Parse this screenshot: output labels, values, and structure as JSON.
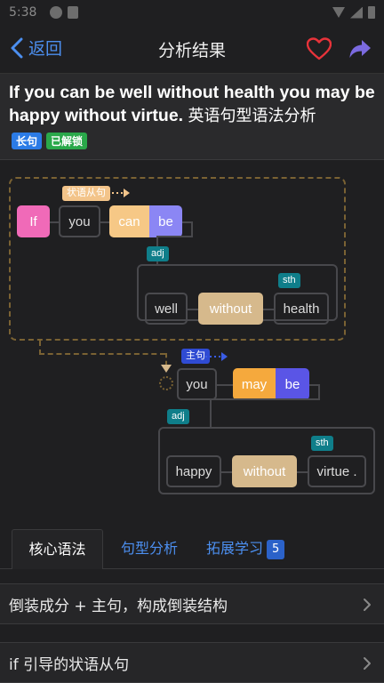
{
  "status_bar": {
    "time": "5:38"
  },
  "navbar": {
    "back_label": "返回",
    "title": "分析结果",
    "accent_color": "#4c8ff0",
    "heart_color": "#e8333a",
    "share_color": "#7b6ae0"
  },
  "sentence": {
    "english": "If you can be well without health you may be happy without virtue.",
    "chinese": "英语句型语法分析",
    "badges": [
      {
        "label": "长句",
        "color": "#2b7be6"
      },
      {
        "label": "已解锁",
        "color": "#2aa84a"
      }
    ]
  },
  "diagram": {
    "clause_tag": "状语从句",
    "main_tag": "主句",
    "clause_words": [
      "If",
      "you",
      "can",
      "be"
    ],
    "clause_adj_tag": "adj",
    "clause_sth_tag": "sth",
    "clause_complement": [
      "well",
      "without",
      "health"
    ],
    "main_words": [
      "you",
      "may",
      "be"
    ],
    "main_adj_tag": "adj",
    "main_sth_tag": "sth",
    "main_complement": [
      "happy",
      "without",
      "virtue ."
    ]
  },
  "tabs": [
    {
      "label": "核心语法",
      "active": true
    },
    {
      "label": "句型分析",
      "active": false
    },
    {
      "label": "拓展学习",
      "active": false,
      "count": "5"
    }
  ],
  "list": [
    {
      "label": "倒装成分 + 主句，构成倒装结构"
    },
    {
      "label": "if 引导的状语从句"
    }
  ]
}
